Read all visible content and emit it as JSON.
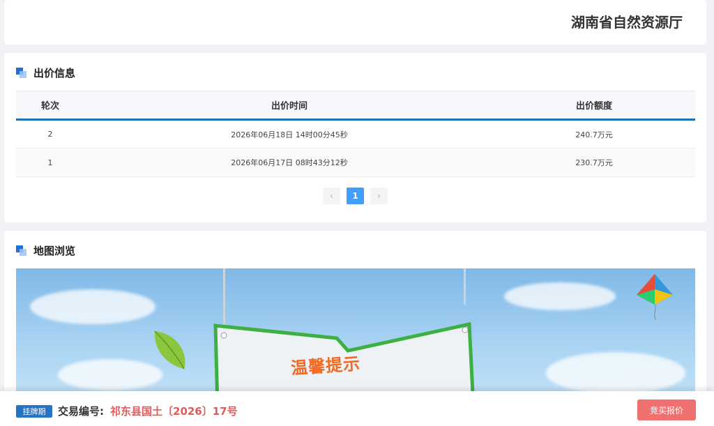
{
  "header": {
    "org_name": "湖南省自然资源厅"
  },
  "bid_section": {
    "title": "出价信息",
    "columns": [
      "轮次",
      "出价时间",
      "出价额度"
    ],
    "rows": [
      {
        "round": "2",
        "time": "2026年06月18日 14时00分45秒",
        "amount": "240.7万元"
      },
      {
        "round": "1",
        "time": "2026年06月17日 08时43分12秒",
        "amount": "230.7万元"
      }
    ],
    "pagination": {
      "prev": "‹",
      "current": "1",
      "next": "›"
    }
  },
  "map_section": {
    "title": "地图浏览",
    "sign_text": "温馨提示"
  },
  "footer": {
    "status_badge": "挂牌期",
    "trade_label": "交易编号:",
    "trade_number": "祁东县国土〔2026〕17号",
    "bid_button": "竞买报价"
  },
  "colors": {
    "accent": "#1f6fb3",
    "page_active": "#409eff",
    "badge": "#2573c5",
    "trade_number": "#e45a5a",
    "bid_button": "#f07070"
  }
}
